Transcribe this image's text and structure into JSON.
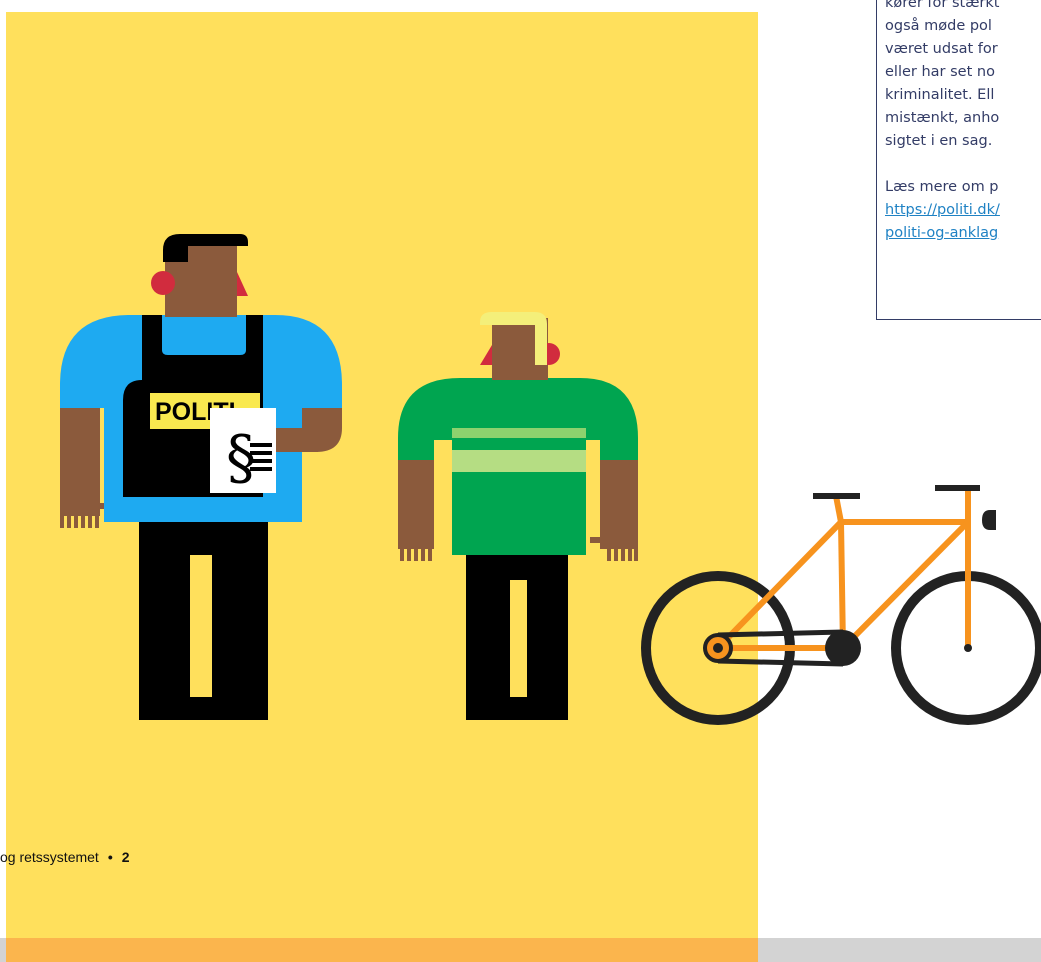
{
  "info_box": {
    "lines": [
      "kører for stærkt",
      "også møde pol",
      "været udsat for",
      "eller har set no",
      "kriminalitet. Ell",
      "mistænkt, anho",
      "sigtet i en sag."
    ],
    "read_more": "Læs mere om p",
    "link_lines": [
      "https://politi.dk/",
      "politi-og-anklag"
    ]
  },
  "footer": {
    "text": "og retssystemet",
    "bullet": "•",
    "page_number": "2"
  },
  "illustration": {
    "vest_label": "POLITI",
    "document_symbol": "§"
  },
  "colors": {
    "background_panel": "#FFE05C",
    "bottom_bar_accent": "#FBB54D",
    "bottom_bar_grey": "#D3D3D3",
    "police_shirt": "#1EAAF1",
    "civilian_shirt": "#00A550",
    "bicycle_frame": "#F7931E",
    "skin": "#8B5A3C",
    "text_dark": "#333C66",
    "link": "#1F82C4"
  }
}
